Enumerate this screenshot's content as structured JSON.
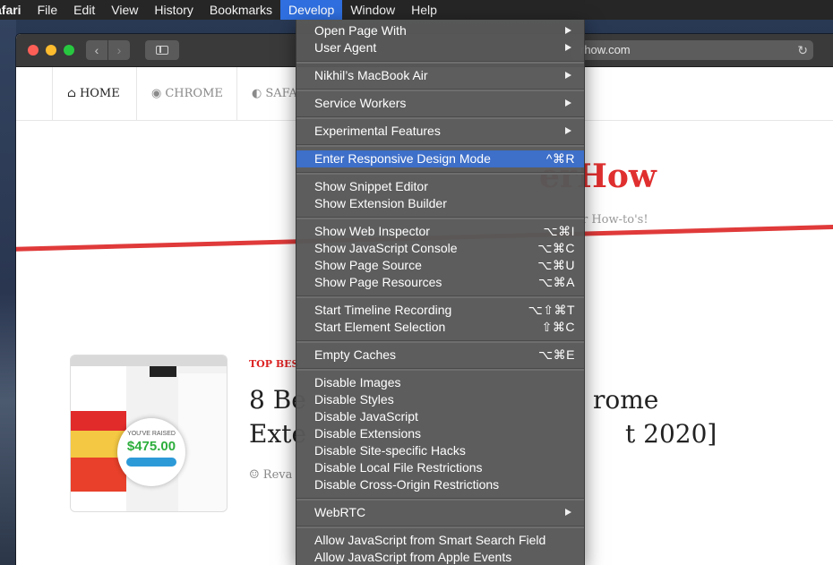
{
  "menubar": {
    "items": [
      "afari",
      "File",
      "Edit",
      "View",
      "History",
      "Bookmarks",
      "Develop",
      "Window",
      "Help"
    ],
    "active": "Develop"
  },
  "browser": {
    "address": "rhow.com",
    "nav": {
      "home": "HOME",
      "chrome": "CHROME",
      "safari": "SAFA"
    }
  },
  "page": {
    "logo": "erHow",
    "tagline": "r How-to's!",
    "category": "TOP BES",
    "title_line1_start": "8 Be",
    "title_line1_end": "rome",
    "title_line2_start": "Exte",
    "title_line2_end": "t 2020]",
    "author": "Reva",
    "thumb_raised": "YOU'VE RAISED",
    "thumb_amount": "$475.00"
  },
  "develop_menu": {
    "groups": [
      [
        {
          "label": "Open Page With",
          "submenu": true
        },
        {
          "label": "User Agent",
          "submenu": true
        }
      ],
      [
        {
          "label": "Nikhil’s MacBook Air",
          "submenu": true
        }
      ],
      [
        {
          "label": "Service Workers",
          "submenu": true
        }
      ],
      [
        {
          "label": "Experimental Features",
          "submenu": true
        }
      ],
      [
        {
          "label": "Enter Responsive Design Mode",
          "shortcut": "^⌘R",
          "highlighted": true
        }
      ],
      [
        {
          "label": "Show Snippet Editor"
        },
        {
          "label": "Show Extension Builder"
        }
      ],
      [
        {
          "label": "Show Web Inspector",
          "shortcut": "⌥⌘I"
        },
        {
          "label": "Show JavaScript Console",
          "shortcut": "⌥⌘C"
        },
        {
          "label": "Show Page Source",
          "shortcut": "⌥⌘U"
        },
        {
          "label": "Show Page Resources",
          "shortcut": "⌥⌘A"
        }
      ],
      [
        {
          "label": "Start Timeline Recording",
          "shortcut": "⌥⇧⌘T"
        },
        {
          "label": "Start Element Selection",
          "shortcut": "⇧⌘C"
        }
      ],
      [
        {
          "label": "Empty Caches",
          "shortcut": "⌥⌘E"
        }
      ],
      [
        {
          "label": "Disable Images"
        },
        {
          "label": "Disable Styles"
        },
        {
          "label": "Disable JavaScript"
        },
        {
          "label": "Disable Extensions"
        },
        {
          "label": "Disable Site-specific Hacks"
        },
        {
          "label": "Disable Local File Restrictions"
        },
        {
          "label": "Disable Cross-Origin Restrictions"
        }
      ],
      [
        {
          "label": "WebRTC",
          "submenu": true
        }
      ],
      [
        {
          "label": "Allow JavaScript from Smart Search Field"
        },
        {
          "label": "Allow JavaScript from Apple Events"
        }
      ]
    ]
  },
  "colors": {
    "accent": "#3e6fc9",
    "brand_red": "#e02f2f",
    "menu_bg": "#585858"
  }
}
